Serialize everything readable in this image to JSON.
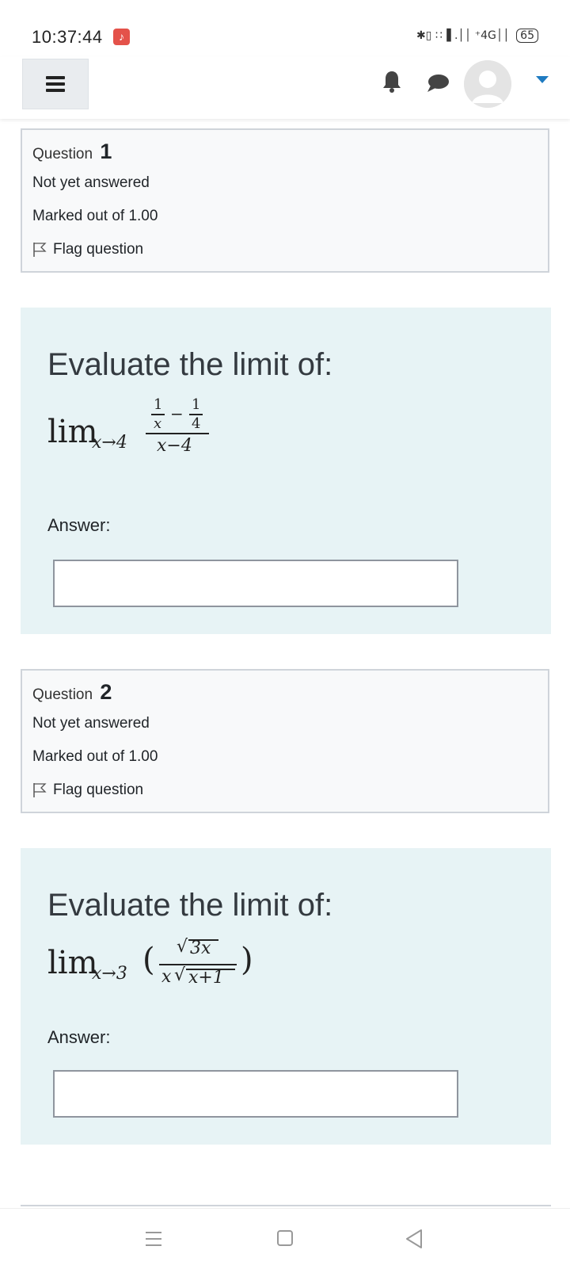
{
  "status_bar": {
    "time": "10:37:44",
    "network": "✱▯ ∷▐ .││ ⁺4G││",
    "battery": "65"
  },
  "header": {
    "menu_icon": "hamburger-icon",
    "notifications_icon": "bell-icon",
    "messages_icon": "chat-bubble-icon",
    "user_menu_icon": "caret-down-icon"
  },
  "questions": [
    {
      "label": "Question",
      "number": "1",
      "state": "Not yet answered",
      "grade": "Marked out of 1.00",
      "flag_label": "Flag question",
      "text": "Evaluate the limit of:",
      "formula": {
        "lim": "lim",
        "sub": "x→4",
        "num_a_top": "1",
        "num_a_bottom": "x",
        "minus": "−",
        "num_b_top": "1",
        "num_b_bottom": "4",
        "den": "x−4"
      },
      "answer_label": "Answer:",
      "answer_value": ""
    },
    {
      "label": "Question",
      "number": "2",
      "state": "Not yet answered",
      "grade": "Marked out of 1.00",
      "flag_label": "Flag question",
      "text": "Evaluate the limit of:",
      "formula": {
        "lim": "lim",
        "sub": "x→3",
        "lparen": "(",
        "num": "3x",
        "den_x": "x",
        "den_rad": "x+1",
        "rparen": ")"
      },
      "answer_label": "Answer:",
      "answer_value": ""
    }
  ],
  "nav": {
    "recent_icon": "recent-apps-icon",
    "home_icon": "home-icon",
    "back_icon": "back-icon"
  }
}
